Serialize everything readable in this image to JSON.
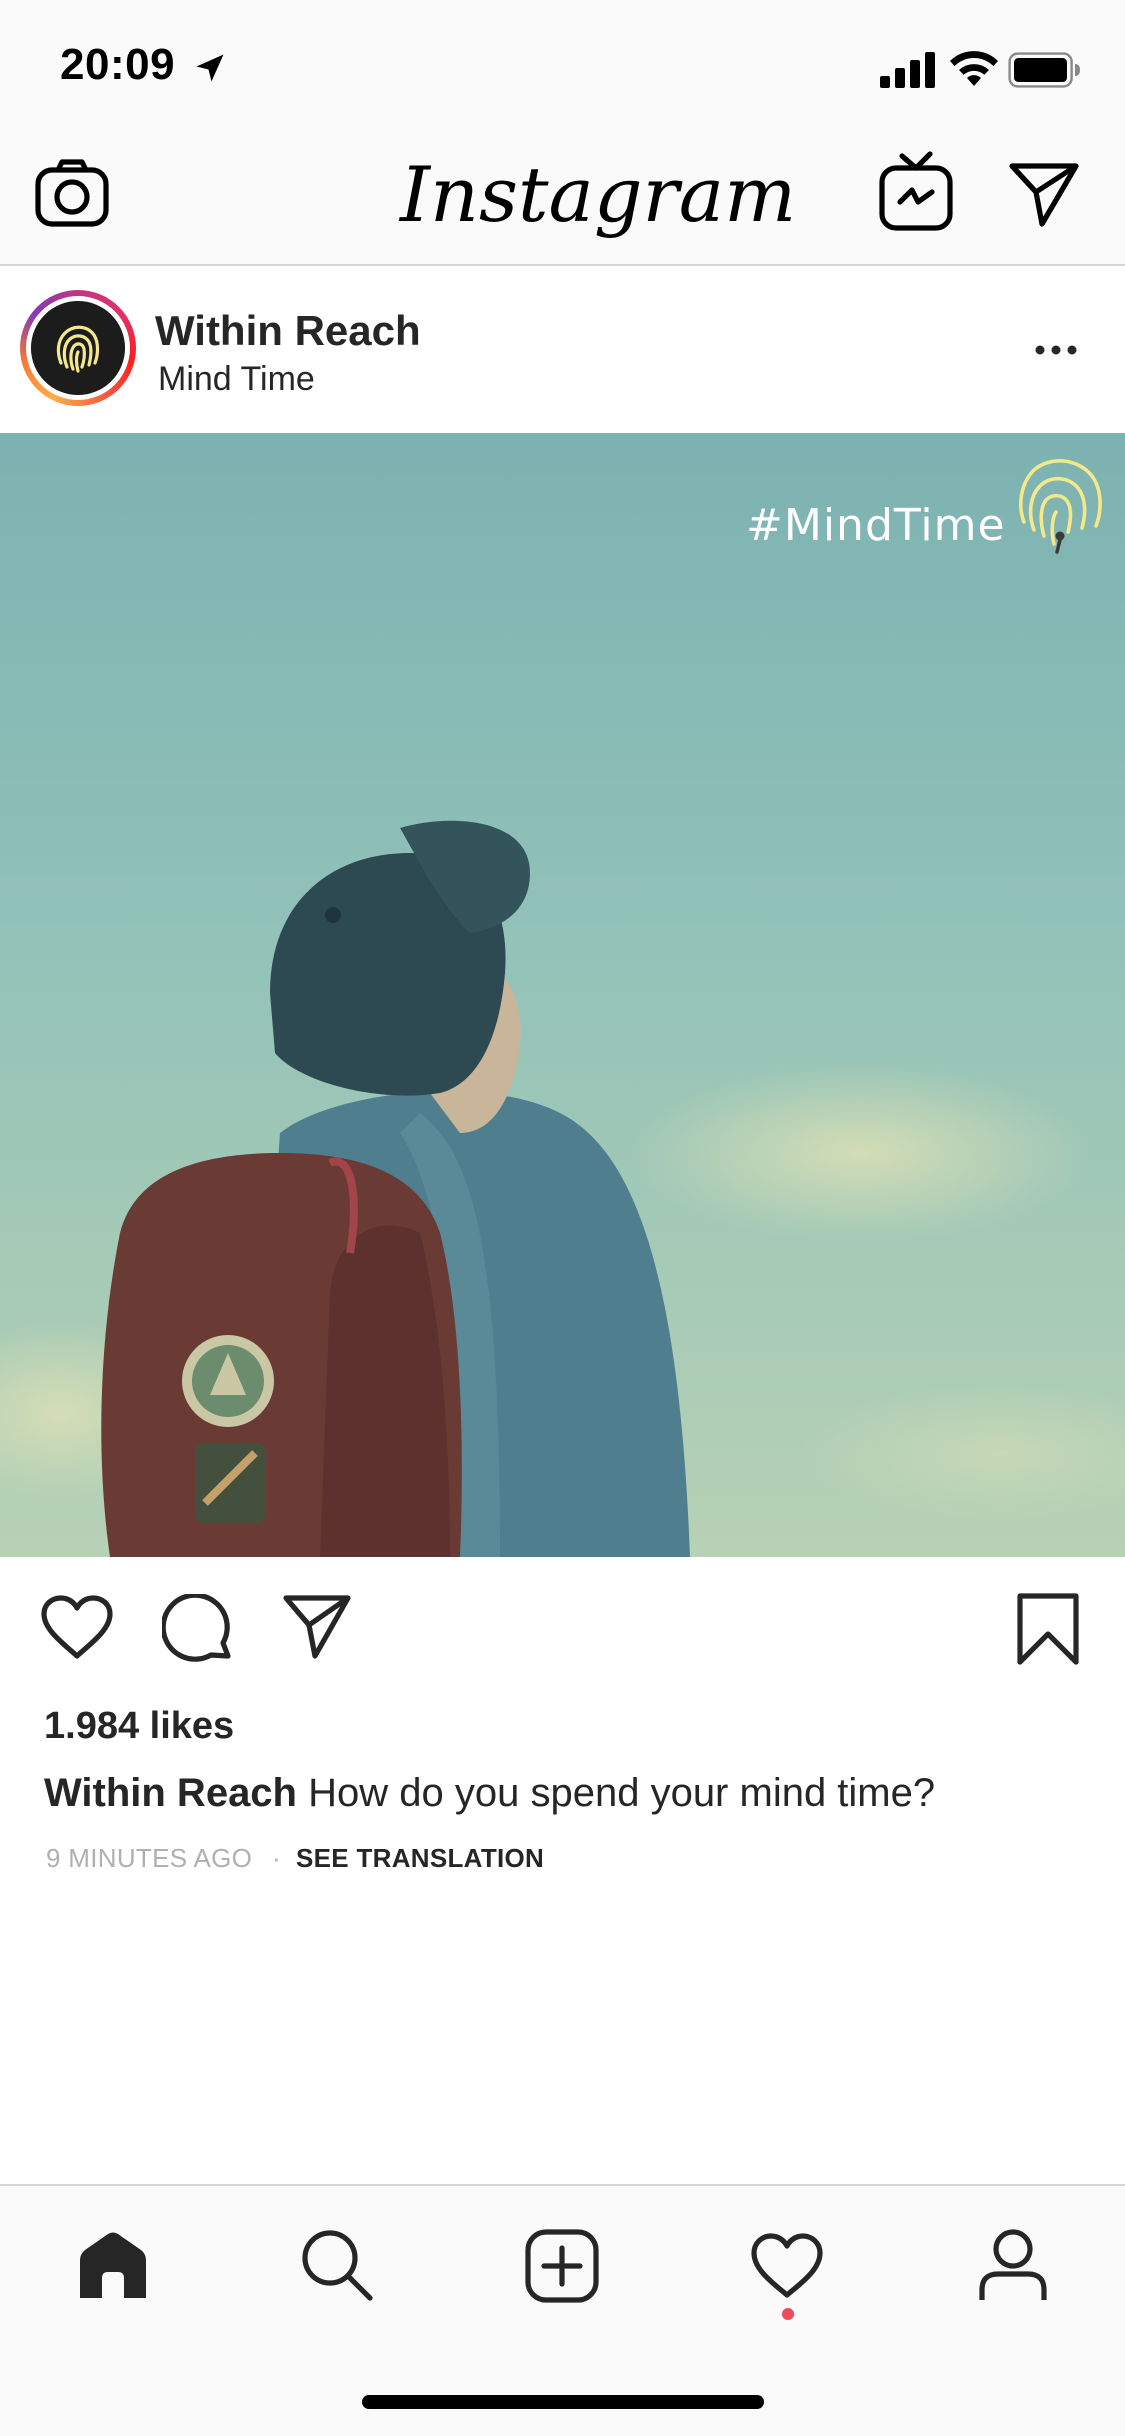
{
  "status_bar": {
    "time": "20:09"
  },
  "header": {
    "app_name": "Instagram"
  },
  "post": {
    "username": "Within Reach",
    "location": "Mind Time",
    "image_overlay_text": "#MindTime",
    "likes": "1.984 likes",
    "caption_user": "Within Reach",
    "caption_text": "How do you spend your mind time?",
    "time_ago": "9 MINUTES AGO",
    "separator": "·",
    "translate_label": "SEE TRANSLATION"
  },
  "tabbar": {
    "items": [
      "home",
      "search",
      "add",
      "activity",
      "profile"
    ],
    "activity_notification": true
  },
  "colors": {
    "notification_dot": "#ed4956",
    "fingerprint_yellow": "#f3e98c",
    "sky_teal": "#8dbfb8"
  }
}
